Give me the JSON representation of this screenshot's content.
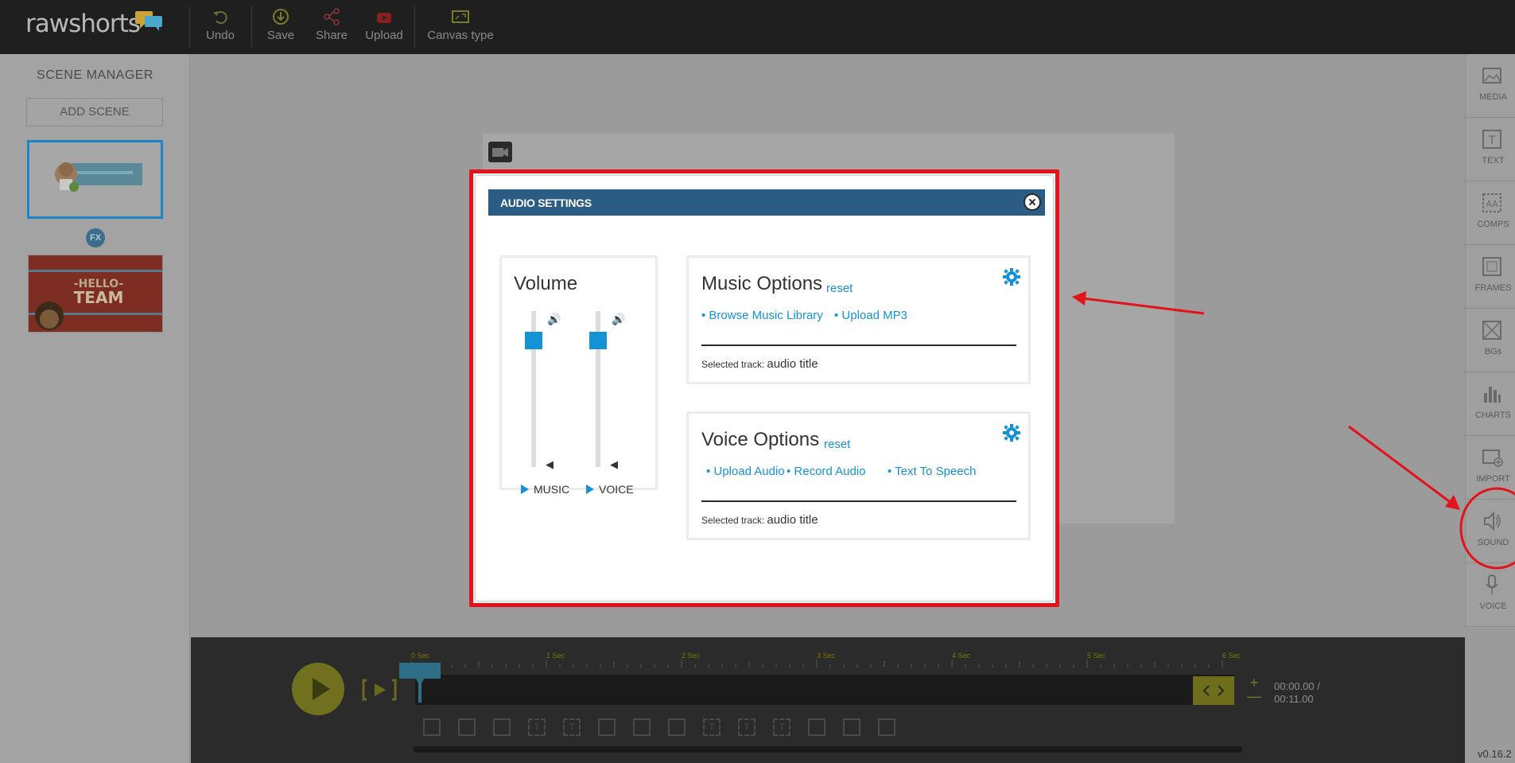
{
  "app": {
    "logo": "rawshorts",
    "version": "v0.16.2"
  },
  "toolbar": {
    "undo_label": "Undo",
    "save_label": "Save",
    "share_label": "Share",
    "upload_label": "Upload",
    "canvas_type_label": "Canvas type"
  },
  "scene_manager": {
    "title": "SCENE MANAGER",
    "add_scene_label": "ADD SCENE",
    "fx_badge": "FX",
    "scene2_text": "-HELLO- TEAM"
  },
  "sidebar": {
    "items": [
      {
        "label": "MEDIA",
        "icon": "image-icon"
      },
      {
        "label": "TEXT",
        "icon": "text-icon"
      },
      {
        "label": "COMPS",
        "icon": "comps-icon"
      },
      {
        "label": "FRAMES",
        "icon": "frame-icon"
      },
      {
        "label": "BGs",
        "icon": "background-icon"
      },
      {
        "label": "CHARTS",
        "icon": "chart-icon"
      },
      {
        "label": "IMPORT",
        "icon": "import-icon"
      },
      {
        "label": "SOUND",
        "icon": "speaker-icon"
      },
      {
        "label": "VOICE",
        "icon": "microphone-icon"
      }
    ]
  },
  "timeline": {
    "ticks": [
      "0 Sec",
      "1 Sec",
      "2 Sec",
      "3 Sec",
      "4 Sec",
      "5 Sec",
      "6 Sec"
    ],
    "time_current": "00:00.00 /",
    "time_total": "00:11.00",
    "zoom_in": "+",
    "zoom_out": "—"
  },
  "audio_settings": {
    "title": "AUDIO SETTINGS",
    "volume": {
      "title": "Volume",
      "music_label": "MUSIC",
      "voice_label": "VOICE",
      "music_level": 0.85,
      "voice_level": 0.85
    },
    "music_options": {
      "title": "Music Options",
      "reset_label": "reset",
      "links": [
        "• Browse Music Library",
        "• Upload MP3"
      ],
      "selected_label": "Selected track:",
      "selected_value": "audio title"
    },
    "voice_options": {
      "title": "Voice Options",
      "reset_label": "reset",
      "links": [
        "• Upload Audio",
        "• Record Audio",
        "• Text To Speech"
      ],
      "selected_label": "Selected track:",
      "selected_value": "audio title"
    }
  },
  "colors": {
    "accent": "#1492d6",
    "header": "#2a5c84",
    "annotation": "#e3121b"
  }
}
